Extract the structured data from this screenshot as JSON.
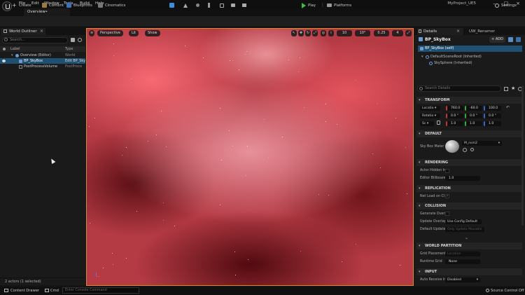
{
  "menu": {
    "items": [
      "File",
      "Edit",
      "Window",
      "Tools",
      "Build",
      "Help"
    ],
    "project_name": "MyProject_UE5",
    "level_tab": "Overview•"
  },
  "toolbar": {
    "create": "Create",
    "content": "Content",
    "blueprints": "Blueprints",
    "cinematics": "Cinematics",
    "play": "Play",
    "platforms": "Platforms",
    "settings": "Settings"
  },
  "outliner": {
    "tab_title": "World Outliner",
    "search_placeholder": "Search...",
    "col_label": "Label",
    "col_type": "Type",
    "rows": [
      {
        "label": "Overview (Editor)",
        "type": "World"
      },
      {
        "label": "BP_SkyBox",
        "type": "Edit BP_Sky"
      },
      {
        "label": "PostProcessVolume",
        "type": "PostProce"
      }
    ],
    "status": "2 actors (1 selected)"
  },
  "viewport": {
    "perspective": "Perspective",
    "lit": "Lit",
    "show": "Show",
    "grid_snap": "10",
    "rot_snap": "10°",
    "scale_snap": "0.25",
    "cam_speed": "4",
    "sky_colors": {
      "base": "#b43a44",
      "highlight": "#f0a0aa",
      "shadow": "#460a0f"
    }
  },
  "details": {
    "tab_details": "Details",
    "tab_renamer": "UW_Renamer",
    "actor_name": "BP_SkyBox",
    "add_label": "ADD",
    "self": "BP_SkyBox  (self)",
    "components": [
      "DefaultSceneRoot (Inherited)",
      "SkySphere (Inherited)"
    ],
    "search_placeholder": "Search Details",
    "sections": {
      "transform": "TRANSFORM",
      "default": "DEFAULT",
      "rendering": "RENDERING",
      "replication": "REPLICATION",
      "collision": "COLLISION",
      "world_partition": "WORLD PARTITION",
      "input": "INPUT"
    },
    "transform": {
      "location_label": "Locatio",
      "rotation_label": "Rotatio",
      "scale_label": "Sc",
      "location": [
        "760.0",
        "-60.0",
        "100.0"
      ],
      "rotation": [
        "0.0 °",
        "0.0 °",
        "0.0 °"
      ],
      "scale": [
        "1.0",
        "1.0",
        "1.0"
      ]
    },
    "default": {
      "sky_box_label": "Sky Box Mater",
      "material": "M_nsm2"
    },
    "rendering": {
      "actor_hidden_label": "Actor Hidden Ir",
      "editor_billboard_label": "Editor Billboare",
      "editor_billboard_value": "1.0"
    },
    "replication": {
      "net_load_label": "Net Load on Cl"
    },
    "collision": {
      "generate_overlap_label": "Generate Overl",
      "update_overlaps_label": "Update Overlap",
      "update_overlaps_value": "Use Config Default",
      "default_update_label": "Default Update",
      "default_update_value": "Only Update Movable"
    },
    "world_partition": {
      "grid_placement_label": "Grid Placement",
      "grid_placement_value": "Location",
      "runtime_grid_label": "Runtime Grid",
      "runtime_grid_value": "None"
    },
    "input": {
      "auto_receive_label": "Auto Receive Ir",
      "auto_receive_value": "Disabled"
    }
  },
  "statusbar": {
    "content_drawer": "Content Drawer",
    "cmd": "Cmd",
    "console_placeholder": "Enter Console Command",
    "source_control": "Source Control Off"
  }
}
